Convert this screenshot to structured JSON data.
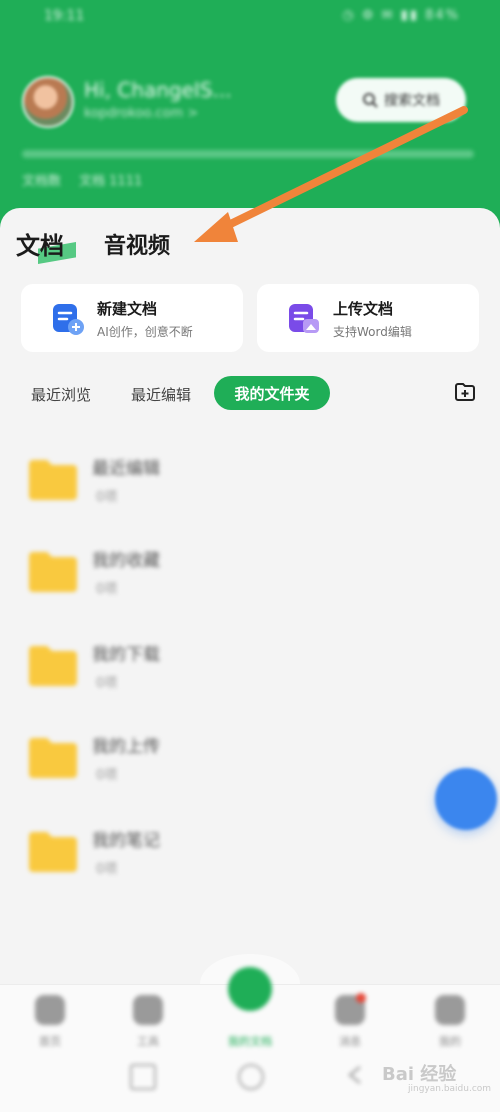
{
  "status_bar": {
    "time": "19:11",
    "right": "◷ ⚙ ✉ ▮▮ 84%"
  },
  "profile": {
    "name": "Hi, ChangeIS...",
    "subtitle": "kopdrokoo.com >",
    "search_label": "搜索文档"
  },
  "stats": [
    "文档数",
    "文档 1111"
  ],
  "doc_tabs": {
    "doc": "文档",
    "media": "音视频"
  },
  "quick_actions": {
    "new_doc": {
      "title": "新建文档",
      "subtitle": "AI创作，创意不断"
    },
    "upload_doc": {
      "title": "上传文档",
      "subtitle": "支持Word编辑"
    }
  },
  "filters": {
    "recent_view": "最近浏览",
    "recent_edit": "最近编辑",
    "my_folders": "我的文件夹"
  },
  "folders": [
    {
      "name": "最近编辑",
      "count": "0项"
    },
    {
      "name": "我的收藏",
      "count": "0项"
    },
    {
      "name": "我的下载",
      "count": "0项"
    },
    {
      "name": "我的上传",
      "count": "0项"
    },
    {
      "name": "我的笔记",
      "count": "0项"
    }
  ],
  "bottom_nav": [
    {
      "label": "首页",
      "icon": "home-icon"
    },
    {
      "label": "工具",
      "icon": "grid-icon"
    },
    {
      "label": "我的文档",
      "icon": "doc-icon"
    },
    {
      "label": "消息",
      "icon": "bell-icon"
    },
    {
      "label": "我的",
      "icon": "user-icon"
    }
  ],
  "watermark": {
    "main": "Bai 经验",
    "sub": "jingyan.baidu.com"
  },
  "colors": {
    "brand_green": "#1fae57",
    "arrow_orange": "#f0843a",
    "fab_blue": "#3b86ee",
    "folder_yellow": "#f9c93f"
  }
}
